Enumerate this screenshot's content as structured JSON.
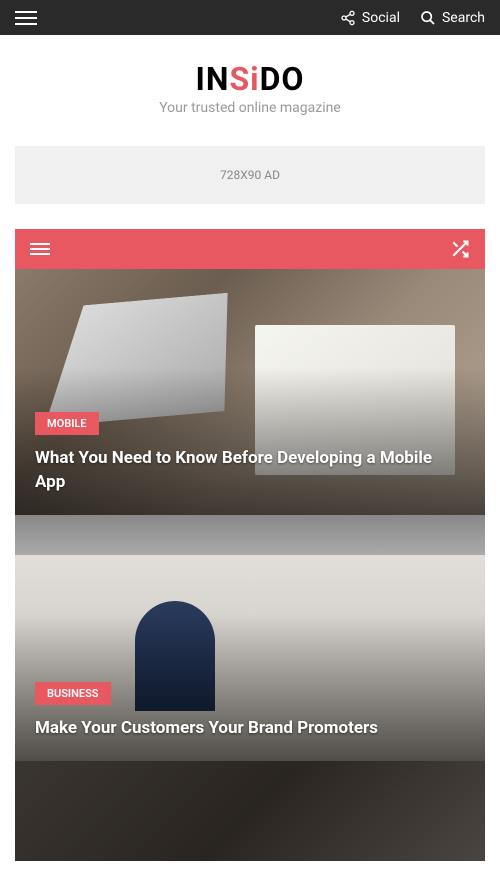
{
  "topbar": {
    "social_label": "Social",
    "search_label": "Search"
  },
  "logo": {
    "part1": "IN",
    "part2": "Si",
    "part3": "DO",
    "tagline": "Your trusted online magazine"
  },
  "ad": {
    "label": "728X90 AD"
  },
  "articles": [
    {
      "category": "MOBILE",
      "title": "What You Need to Know Before Developing a Mobile App"
    },
    {
      "category": "BUSINESS",
      "title": "Make Your Customers Your Brand Promoters"
    }
  ]
}
